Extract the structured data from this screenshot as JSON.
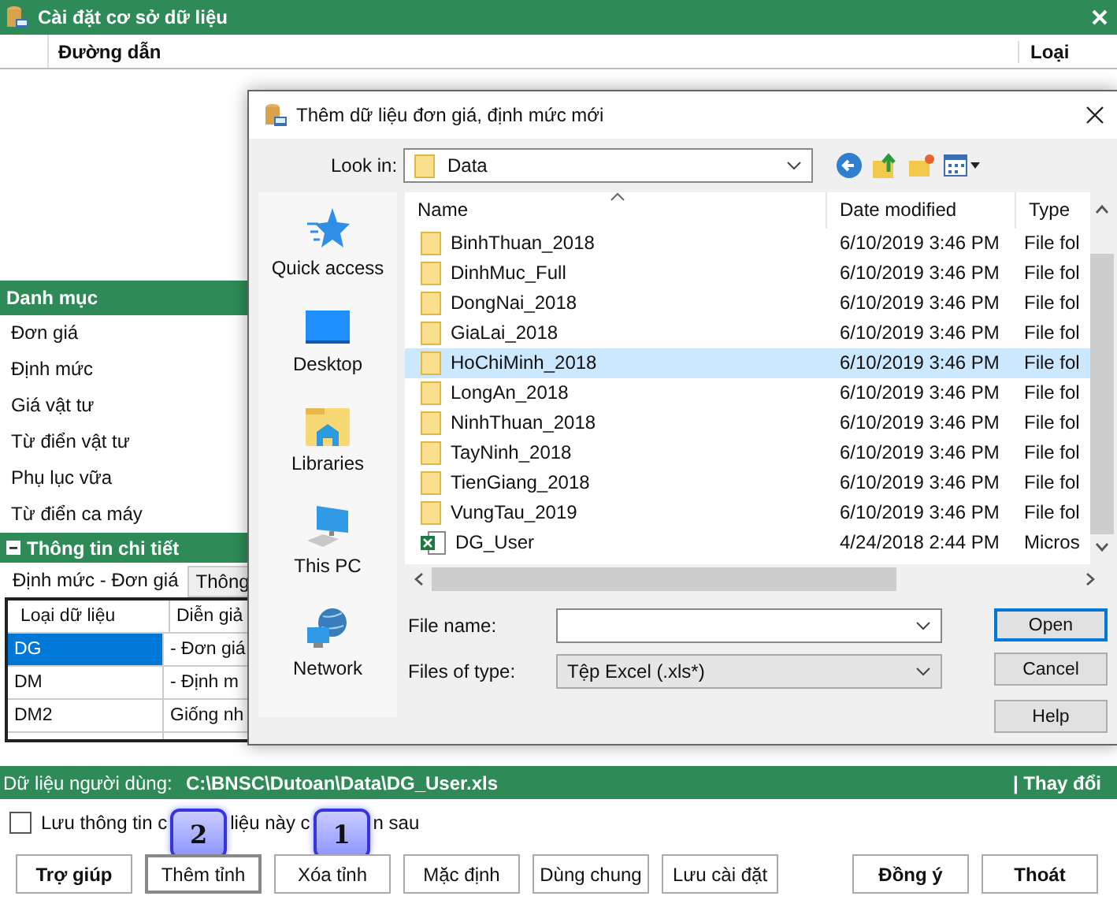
{
  "main_window": {
    "title": "Cài đặt cơ sở dữ liệu",
    "columns": [
      "Đường dẫn",
      "Loại"
    ]
  },
  "categories": {
    "title": "Danh mục",
    "items": [
      {
        "label": "Đơn giá",
        "selected": false
      },
      {
        "label": "Định mức",
        "selected": false
      },
      {
        "label": "Giá vật tư",
        "selected": false
      },
      {
        "label": "Từ điển vật tư",
        "selected": false
      },
      {
        "label": "Phụ lục vữa",
        "selected": false
      },
      {
        "label": "Từ điển ca máy",
        "selected": false
      }
    ]
  },
  "details": {
    "title": "Thông tin chi tiết",
    "expanded": true,
    "tabs": [
      {
        "label": "Định mức - Đơn giá",
        "selected": true
      },
      {
        "label": "Thông",
        "selected": false
      }
    ],
    "table": {
      "columns": [
        "Loại dữ liệu",
        "Diễn giả"
      ],
      "rows": [
        {
          "cells": [
            "DG",
            "- Đơn giá"
          ],
          "selected": true
        },
        {
          "cells": [
            "DM",
            "- Định m"
          ],
          "selected": false
        },
        {
          "cells": [
            "DM2",
            "Giống nh"
          ],
          "selected": false
        }
      ]
    }
  },
  "user_data": {
    "label": "Dữ liệu người dùng:",
    "path": "C:\\BNSC\\Dutoan\\Data\\DG_User.xls",
    "change_link": "| Thay đổi"
  },
  "save_option": {
    "checked": false,
    "segments": [
      {
        "kind": "text",
        "text": "Lưu thông tin c"
      },
      {
        "kind": "badge",
        "text": "2"
      },
      {
        "kind": "text",
        "text": "liệu này c"
      },
      {
        "kind": "badge",
        "text": "1"
      },
      {
        "kind": "text",
        "text": "n sau"
      }
    ]
  },
  "buttons": [
    {
      "label": "Trợ giúp",
      "bold": true,
      "focused": false
    },
    {
      "label": "Thêm tỉnh",
      "bold": false,
      "focused": true
    },
    {
      "label": "Xóa tỉnh",
      "bold": false,
      "focused": false
    },
    {
      "label": "Mặc định",
      "bold": false,
      "focused": false
    },
    {
      "label": "Dùng chung",
      "bold": false,
      "focused": false
    },
    {
      "label": "Lưu cài đặt",
      "bold": false,
      "focused": false
    }
  ],
  "confirm_buttons": [
    {
      "label": "Đồng ý",
      "bold": true,
      "focused": false
    },
    {
      "label": "Thoát",
      "bold": true,
      "focused": false
    }
  ],
  "dialog": {
    "title": "Thêm dữ liệu đơn giá, định mức mới",
    "look_in_label": "Look in:",
    "look_in": "Data",
    "places": [
      {
        "label": "Quick access",
        "kind": "star"
      },
      {
        "label": "Desktop",
        "kind": "desktop"
      },
      {
        "label": "Libraries",
        "kind": "libraries"
      },
      {
        "label": "This PC",
        "kind": "pc"
      },
      {
        "label": "Network",
        "kind": "network"
      }
    ],
    "columns": [
      "Name",
      "Date modified",
      "Type"
    ],
    "files": [
      {
        "name": "BinhThuan_2018",
        "date": "6/10/2019 3:46 PM",
        "type": "File fol",
        "kind": "folder",
        "selected": false
      },
      {
        "name": "DinhMuc_Full",
        "date": "6/10/2019 3:46 PM",
        "type": "File fol",
        "kind": "folder",
        "selected": false
      },
      {
        "name": "DongNai_2018",
        "date": "6/10/2019 3:46 PM",
        "type": "File fol",
        "kind": "folder",
        "selected": false
      },
      {
        "name": "GiaLai_2018",
        "date": "6/10/2019 3:46 PM",
        "type": "File fol",
        "kind": "folder",
        "selected": false
      },
      {
        "name": "HoChiMinh_2018",
        "date": "6/10/2019 3:46 PM",
        "type": "File fol",
        "kind": "folder",
        "selected": true
      },
      {
        "name": "LongAn_2018",
        "date": "6/10/2019 3:46 PM",
        "type": "File fol",
        "kind": "folder",
        "selected": false
      },
      {
        "name": "NinhThuan_2018",
        "date": "6/10/2019 3:46 PM",
        "type": "File fol",
        "kind": "folder",
        "selected": false
      },
      {
        "name": "TayNinh_2018",
        "date": "6/10/2019 3:46 PM",
        "type": "File fol",
        "kind": "folder",
        "selected": false
      },
      {
        "name": "TienGiang_2018",
        "date": "6/10/2019 3:46 PM",
        "type": "File fol",
        "kind": "folder",
        "selected": false
      },
      {
        "name": "VungTau_2019",
        "date": "6/10/2019 3:46 PM",
        "type": "File fol",
        "kind": "folder",
        "selected": false
      },
      {
        "name": "DG_User",
        "date": "4/24/2018 2:44 PM",
        "type": "Micros",
        "kind": "excel",
        "selected": false
      }
    ],
    "file_name_label": "File name:",
    "file_type_label": "Files of type:",
    "file_type": "Tệp Excel (.xls*)",
    "buttons": [
      {
        "label": "Open",
        "default": true
      },
      {
        "label": "Cancel",
        "default": false
      },
      {
        "label": "Help",
        "default": false
      }
    ]
  }
}
